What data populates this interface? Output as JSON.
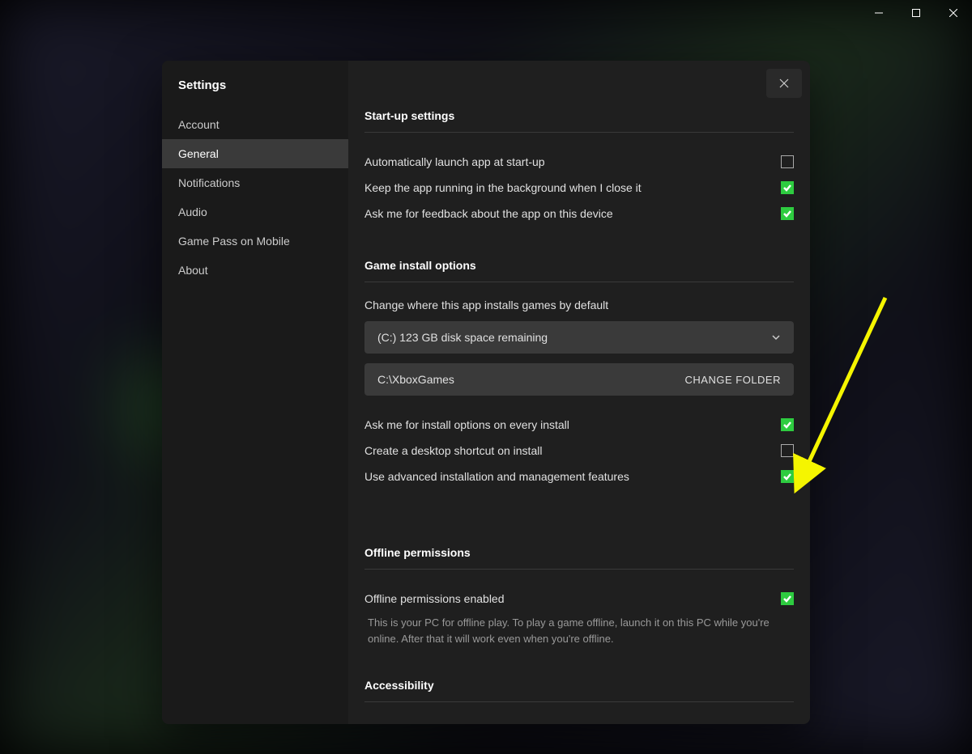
{
  "sidebar": {
    "title": "Settings",
    "items": [
      {
        "label": "Account"
      },
      {
        "label": "General"
      },
      {
        "label": "Notifications"
      },
      {
        "label": "Audio"
      },
      {
        "label": "Game Pass on Mobile"
      },
      {
        "label": "About"
      }
    ],
    "activeIndex": 1
  },
  "sections": {
    "startup": {
      "title": "Start-up settings",
      "rows": [
        {
          "label": "Automatically launch app at start-up",
          "checked": false
        },
        {
          "label": "Keep the app running in the background when I close it",
          "checked": true
        },
        {
          "label": "Ask me for feedback about the app on this device",
          "checked": true
        }
      ]
    },
    "install": {
      "title": "Game install options",
      "desc": "Change where this app installs games by default",
      "drive": "(C:) 123 GB disk space remaining",
      "folder": "C:\\XboxGames",
      "changeFolderLabel": "CHANGE FOLDER",
      "rows": [
        {
          "label": "Ask me for install options on every install",
          "checked": true
        },
        {
          "label": "Create a desktop shortcut on install",
          "checked": false
        },
        {
          "label": "Use advanced installation and management features",
          "checked": true
        }
      ]
    },
    "offline": {
      "title": "Offline permissions",
      "row": {
        "label": "Offline permissions enabled",
        "checked": true
      },
      "helper": "This is your PC for offline play. To play a game offline, launch it on this PC while you're online. After that it will work even when you're offline."
    },
    "accessibility": {
      "title": "Accessibility"
    }
  }
}
